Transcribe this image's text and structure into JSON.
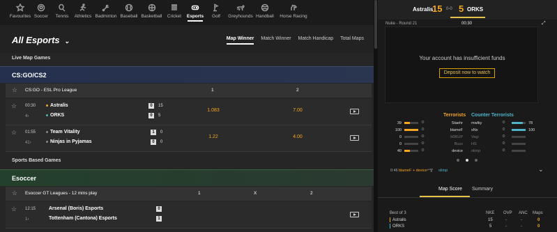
{
  "sports": [
    {
      "label": "Favourites",
      "icon": "star-icon"
    },
    {
      "label": "Soccer",
      "icon": "soccer-ball-icon"
    },
    {
      "label": "Tennis",
      "icon": "tennis-icon"
    },
    {
      "label": "Athletics",
      "icon": "athletics-icon"
    },
    {
      "label": "Badminton",
      "icon": "badminton-icon"
    },
    {
      "label": "Baseball",
      "icon": "baseball-icon"
    },
    {
      "label": "Basketball",
      "icon": "basketball-icon"
    },
    {
      "label": "Cricket",
      "icon": "cricket-icon"
    },
    {
      "label": "Esports",
      "icon": "gamepad-icon",
      "active": true
    },
    {
      "label": "Golf",
      "icon": "golf-icon"
    },
    {
      "label": "Greyhounds",
      "icon": "greyhound-icon"
    },
    {
      "label": "Handball",
      "icon": "handball-icon"
    },
    {
      "label": "Horse Racing",
      "icon": "horse-icon"
    }
  ],
  "header": {
    "title": "All Esports",
    "chevron": "chevron-down-icon",
    "tabs": [
      "Map Winner",
      "Match Winner",
      "Match Handicap",
      "Total Maps"
    ]
  },
  "live_label": "Live Map Games",
  "csgo": {
    "title": "CS:GO/CS2",
    "league": "CS:GO - ESL Pro League",
    "col1": "1",
    "col2": "2"
  },
  "match1": {
    "time": "00:30",
    "sub": "4",
    "team1": "Astralis",
    "team2": "ORKS",
    "map1": "0",
    "map2": "0",
    "round1": "15",
    "round2": "5",
    "odd1": "1.083",
    "odd2": "7.00"
  },
  "match2": {
    "time": "01:55",
    "sub": "41",
    "team1": "Team Vitality",
    "team2": "Ninjas in Pyjamas",
    "map1": "1",
    "map2": "0",
    "round1": "0",
    "round2": "0",
    "odd1": "1.22",
    "odd2": "4.00"
  },
  "sports_label": "Sports Based Games",
  "esoccer": {
    "title": "Esoccer",
    "league": "Esoccer GT Leagues - 12 mins play",
    "col1": "1",
    "colx": "X",
    "col2": "2"
  },
  "match3": {
    "time": "12:15",
    "sub": "1",
    "team1": "Arsenal (Boris) Esports",
    "team2": "Tottenham (Cantona) Esports",
    "s1": "0",
    "s2": "1"
  },
  "scoreboard": {
    "team1": "Astralis",
    "score1": "15",
    "mid": "0-0",
    "score2": "5",
    "team2": "ORKS",
    "round": "Nuke - Round 21",
    "clock": "00:30"
  },
  "video": {
    "message": "Your account has insufficient funds",
    "button": "Deposit now to watch"
  },
  "teams": {
    "t": "Terrorists",
    "ct": "Counter Terrorists"
  },
  "players_t": [
    {
      "hp": "39",
      "name": "Staehr",
      "fill": 0.39
    },
    {
      "hp": "100",
      "name": "blameF",
      "fill": 1.0
    },
    {
      "hp": "0",
      "name": "b0RUP",
      "fill": 0
    },
    {
      "hp": "0",
      "name": "Buzz",
      "fill": 0
    },
    {
      "hp": "40",
      "name": "device",
      "fill": 0.4
    }
  ],
  "players_ct": [
    {
      "hp": "78",
      "name": "mwlky",
      "fill": 0.78
    },
    {
      "hp": "100",
      "name": "sNx",
      "fill": 1.0
    },
    {
      "hp": "",
      "name": "Vegi",
      "fill": 0
    },
    {
      "hp": "",
      "name": "HS",
      "fill": 0
    },
    {
      "hp": "",
      "name": "olimp",
      "fill": 0
    }
  ],
  "kill": {
    "time": "0:46",
    "killer": "blameF + device",
    "victim": "olimp"
  },
  "map_tabs": [
    "Map Score",
    "Summary"
  ],
  "table": {
    "title": "Best of 3",
    "cols": [
      "NKE",
      "OVP",
      "ANC",
      "Maps"
    ],
    "rows": [
      [
        "Astralis",
        "15",
        "-",
        "-",
        "0"
      ],
      [
        "ORKS",
        "5",
        "-",
        "-",
        "0"
      ]
    ]
  },
  "colors": {
    "accent": "#f5a623",
    "ct": "#4fb4c9",
    "active_bar": "#e6c34a"
  }
}
